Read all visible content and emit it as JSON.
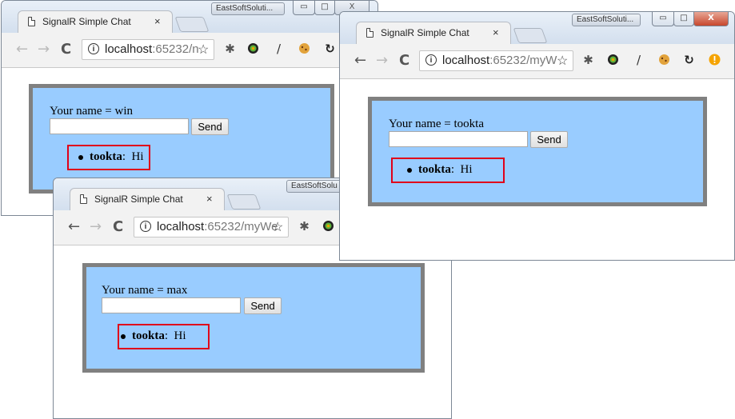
{
  "app_title": "SignalR Simple Chat",
  "vendor_label": "EastSoftSoluti...",
  "vendor_label_short": "EastSoftSolu",
  "tab_close": "×",
  "omnibox": {
    "host": "localhost",
    "w1_rest": ":65232/n",
    "w2_rest": ":65232/myW",
    "w3_rest": ":65232/myWe"
  },
  "nav": {
    "back": "←",
    "forward": "→",
    "reload": "C",
    "info": "i",
    "star": "☆"
  },
  "window_controls": {
    "minimize": "▭",
    "maximize": "□",
    "close": "X"
  },
  "icons": {
    "ext1": "spider-extension-icon",
    "ext2": "color-wheel-extension-icon",
    "ext3": "pen-extension-icon",
    "ext4": "cookie-extension-icon",
    "ext5": "sync-extension-icon",
    "ext6": "alert-extension-icon"
  },
  "send_label": "Send",
  "windows": [
    {
      "name_label": "Your name = win",
      "message": {
        "user": "tookta",
        "sep": ":",
        "text": "Hi"
      }
    },
    {
      "name_label": "Your name = tookta",
      "message": {
        "user": "tookta",
        "sep": ":",
        "text": "Hi"
      }
    },
    {
      "name_label": "Your name = max",
      "message": {
        "user": "tookta",
        "sep": ":",
        "text": "Hi"
      }
    }
  ],
  "colors": {
    "chat_bg": "#99ccff",
    "chat_border": "#808080",
    "highlight": "#e0001a"
  }
}
